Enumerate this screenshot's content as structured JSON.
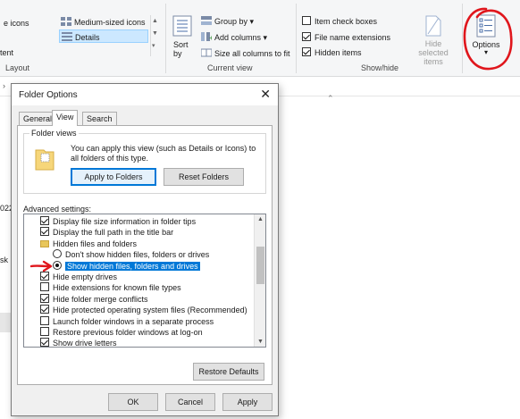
{
  "ribbon": {
    "layout": {
      "partial_icons": "e icons",
      "partial_content": "tent",
      "medium_icons": "Medium-sized icons",
      "details": "Details",
      "group_label": "Layout"
    },
    "current_view": {
      "sort_by": "Sort by",
      "group_by": "Group by",
      "add_columns": "Add columns",
      "size_all_columns": "Size all columns to fit",
      "group_label": "Current view"
    },
    "show_hide": {
      "item_check_boxes": "Item check boxes",
      "item_check_boxes_checked": false,
      "file_name_extensions": "File name extensions",
      "file_name_extensions_checked": true,
      "hidden_items": "Hidden items",
      "hidden_items_checked": true,
      "hide_selected_items": "Hide selected items",
      "group_label": "Show/hide"
    },
    "options": "Options"
  },
  "explorer": {
    "partial_text_1": "022",
    "partial_text_2": "sk"
  },
  "dialog": {
    "title": "Folder Options",
    "tabs": [
      "General",
      "View",
      "Search"
    ],
    "active_tab": "View",
    "folder_views": {
      "label": "Folder views",
      "description": "You can apply this view (such as Details or Icons) to all folders of this type.",
      "apply_button": "Apply to Folders",
      "reset_button": "Reset Folders"
    },
    "advanced": {
      "label": "Advanced settings:",
      "items": [
        {
          "kind": "checkbox",
          "checked": true,
          "label": "Display file size information in folder tips"
        },
        {
          "kind": "checkbox",
          "checked": true,
          "label": "Display the full path in the title bar"
        },
        {
          "kind": "folder",
          "label": "Hidden files and folders"
        },
        {
          "kind": "radio",
          "checked": false,
          "label": "Don't show hidden files, folders or drives"
        },
        {
          "kind": "radio",
          "checked": true,
          "selected": true,
          "label": "Show hidden files, folders and drives"
        },
        {
          "kind": "checkbox",
          "checked": true,
          "label": "Hide empty drives"
        },
        {
          "kind": "checkbox",
          "checked": false,
          "label": "Hide extensions for known file types"
        },
        {
          "kind": "checkbox",
          "checked": true,
          "label": "Hide folder merge conflicts"
        },
        {
          "kind": "checkbox",
          "checked": true,
          "label": "Hide protected operating system files (Recommended)"
        },
        {
          "kind": "checkbox",
          "checked": false,
          "label": "Launch folder windows in a separate process"
        },
        {
          "kind": "checkbox",
          "checked": false,
          "label": "Restore previous folder windows at log-on"
        },
        {
          "kind": "checkbox",
          "checked": true,
          "label": "Show drive letters"
        }
      ]
    },
    "restore_defaults": "Restore Defaults",
    "ok": "OK",
    "cancel": "Cancel",
    "apply": "Apply"
  },
  "colors": {
    "selection": "#0078d7",
    "annotation_red": "#e0161c"
  }
}
